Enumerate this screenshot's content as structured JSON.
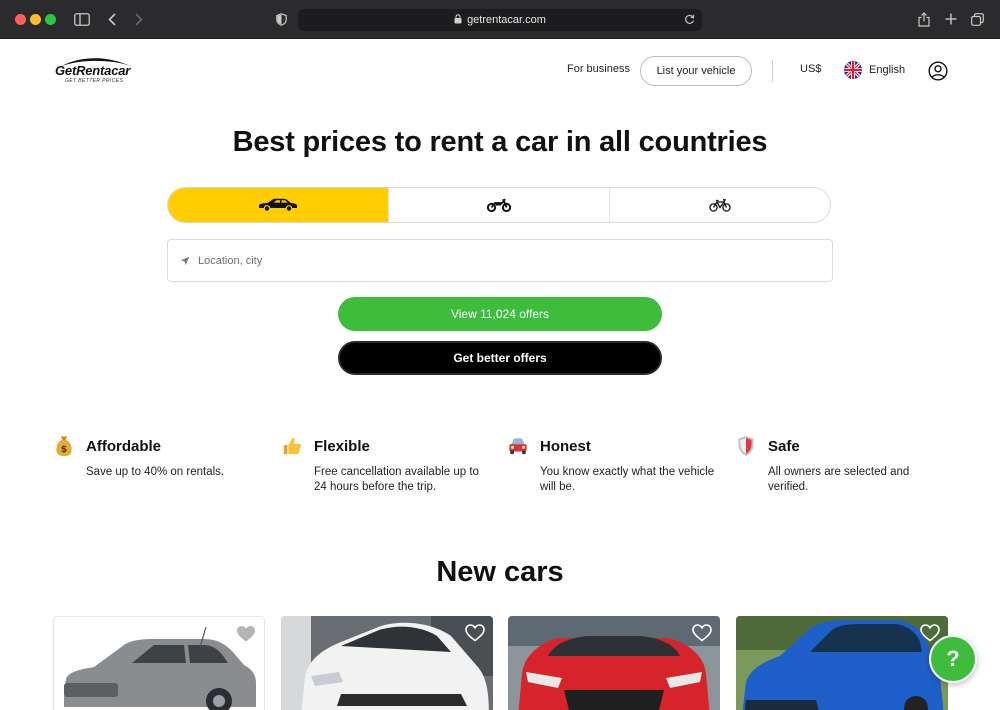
{
  "browser": {
    "url": "getrentacar.com",
    "icons": [
      "sidebar-icon",
      "back-icon",
      "forward-icon",
      "shield-icon",
      "lock-icon",
      "reload-icon",
      "share-icon",
      "new-tab-icon",
      "tabs-icon"
    ]
  },
  "header": {
    "logo_text": "GetRentacar",
    "logo_tagline": "GET BETTER PRICES",
    "for_business": "For business",
    "list_vehicle": "List your vehicle",
    "currency": "US$",
    "language": "English"
  },
  "hero": {
    "title": "Best prices to rent a car in all countries",
    "tabs": [
      {
        "icon": "car-icon",
        "active": true
      },
      {
        "icon": "motorcycle-icon",
        "active": false
      },
      {
        "icon": "bicycle-icon",
        "active": false
      }
    ],
    "location_placeholder": "Location, city",
    "view_offers": "View 11,024 offers",
    "better_offers": "Get better offers"
  },
  "features": [
    {
      "icon": "money-bag-icon",
      "title": "Affordable",
      "desc": "Save up to 40% on rentals."
    },
    {
      "icon": "thumbs-up-icon",
      "title": "Flexible",
      "desc": "Free cancellation available up to 24 hours before the trip."
    },
    {
      "icon": "car-front-icon",
      "title": "Honest",
      "desc": "You know exactly what the vehicle will be."
    },
    {
      "icon": "shield-icon",
      "title": "Safe",
      "desc": "All owners are selected and verified."
    }
  ],
  "new_cars": {
    "title": "New cars",
    "cards": [
      {
        "color": "#8a8d90",
        "bg": "#ffffff"
      },
      {
        "color": "#f2f2f2",
        "bg": "#6a6e72"
      },
      {
        "color": "#d6242a",
        "bg": "#8d959c"
      },
      {
        "color": "#1f5fc9",
        "bg": "#7b9a5a"
      }
    ]
  },
  "help_label": "?",
  "colors": {
    "accent_yellow": "#ffcd00",
    "accent_green": "#3dbd3b",
    "black": "#000000"
  }
}
